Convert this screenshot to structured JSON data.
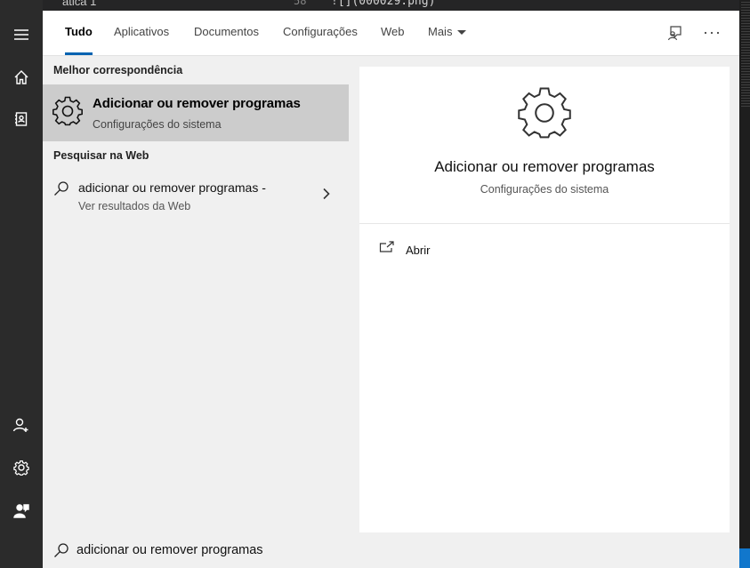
{
  "background": {
    "editor_tab": "ática 1",
    "line_number": "58",
    "code_text": "![](000029.png)"
  },
  "tabs": {
    "items": [
      "Tudo",
      "Aplicativos",
      "Documentos",
      "Configurações",
      "Web",
      "Mais"
    ],
    "active": "Tudo"
  },
  "rail_icons": [
    "hamburger-menu-icon",
    "home-icon",
    "notebook-icon",
    "add-user-icon",
    "settings-gear-icon",
    "user-feedback-icon"
  ],
  "results": {
    "best_match_header": "Melhor correspondência",
    "best_match": {
      "title": "Adicionar ou remover programas",
      "subtitle": "Configurações do sistema",
      "icon": "gear-icon"
    },
    "web_header": "Pesquisar na Web",
    "web_result": {
      "title": "adicionar ou remover programas -",
      "subtitle": "Ver resultados da Web",
      "icon": "search-icon"
    }
  },
  "preview": {
    "title": "Adicionar ou remover programas",
    "subtitle": "Configurações do sistema",
    "action_open": "Abrir",
    "icon": "gear-icon"
  },
  "search": {
    "value": "adicionar ou remover programas"
  },
  "colors": {
    "accent": "#0063b1",
    "panel_bg": "#f0f0f0",
    "rail_bg": "#2b2b2b",
    "selected_bg": "#cccccc"
  }
}
